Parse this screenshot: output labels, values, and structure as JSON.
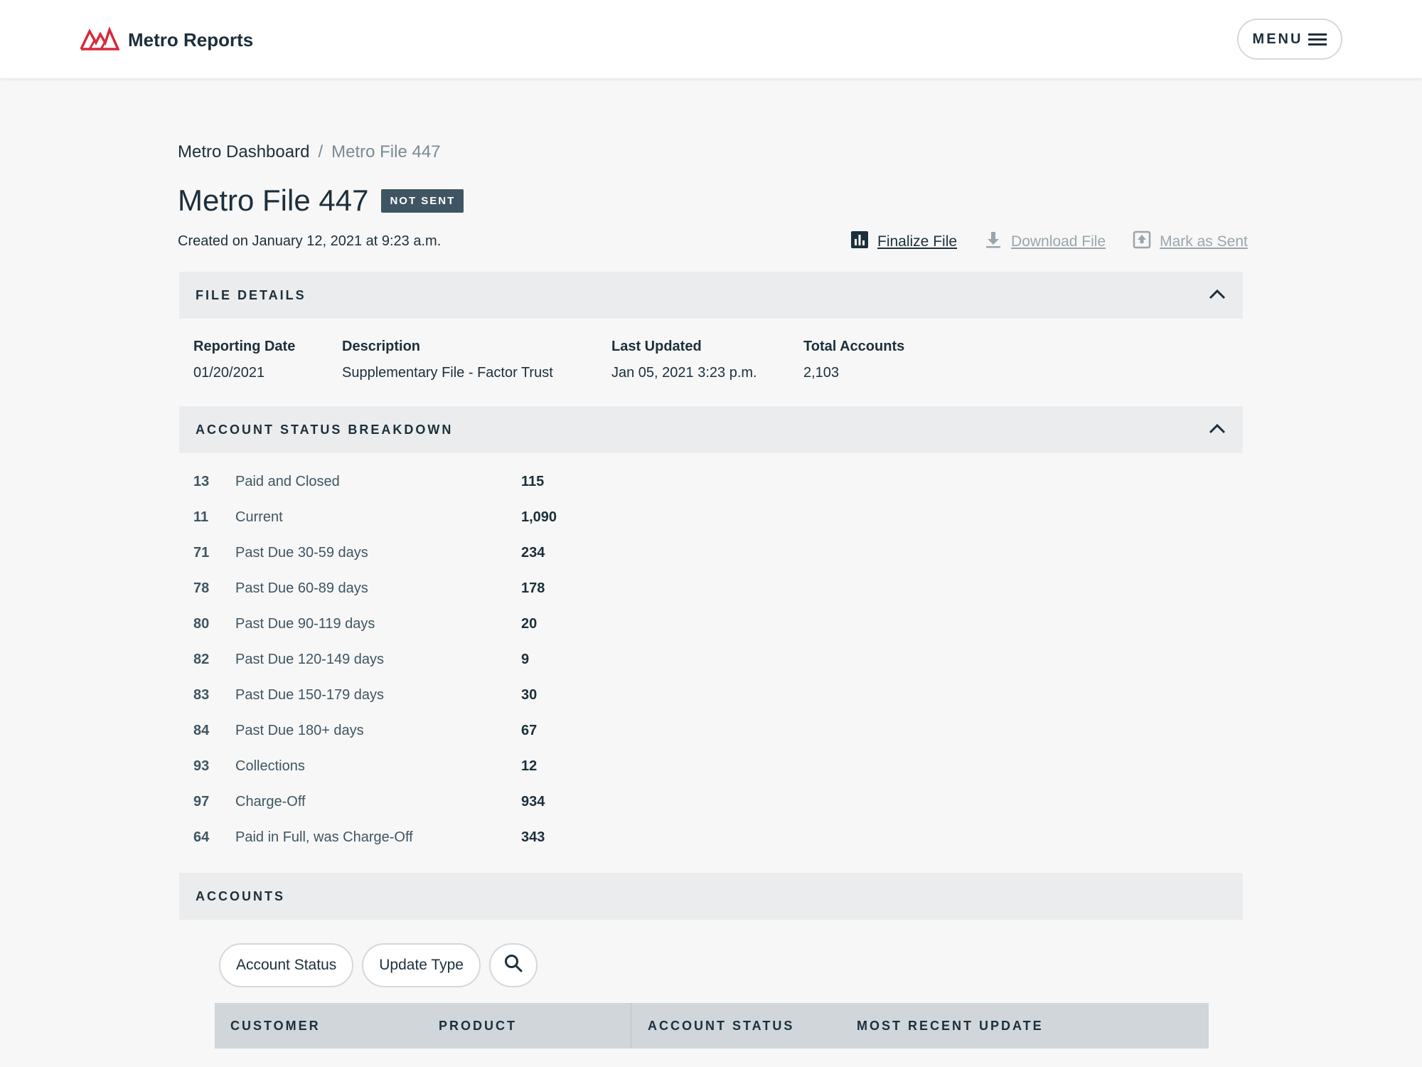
{
  "header": {
    "brand": "Metro Reports",
    "menu_label": "MENU"
  },
  "breadcrumb": {
    "parent": "Metro Dashboard",
    "separator": "/",
    "current": "Metro File 447"
  },
  "file": {
    "title": "Metro File 447",
    "status": "NOT SENT",
    "created": "Created on January 12, 2021 at 9:23 a.m."
  },
  "actions": {
    "finalize": "Finalize File",
    "download": "Download File",
    "mark_sent": "Mark as Sent"
  },
  "file_details": {
    "title": "FILE DETAILS",
    "fields": [
      {
        "label": "Reporting Date",
        "value": "01/20/2021"
      },
      {
        "label": "Description",
        "value": "Supplementary File - Factor Trust"
      },
      {
        "label": "Last Updated",
        "value": "Jan 05, 2021 3:23 p.m."
      },
      {
        "label": "Total Accounts",
        "value": "2,103"
      }
    ]
  },
  "breakdown": {
    "title": "ACCOUNT STATUS BREAKDOWN",
    "rows": [
      {
        "code": "13",
        "name": "Paid and Closed",
        "count": "115"
      },
      {
        "code": "11",
        "name": "Current",
        "count": "1,090"
      },
      {
        "code": "71",
        "name": "Past Due 30-59 days",
        "count": "234"
      },
      {
        "code": "78",
        "name": "Past Due 60-89 days",
        "count": "178"
      },
      {
        "code": "80",
        "name": "Past Due 90-119 days",
        "count": "20"
      },
      {
        "code": "82",
        "name": "Past Due 120-149 days",
        "count": "9"
      },
      {
        "code": "83",
        "name": "Past Due 150-179 days",
        "count": "30"
      },
      {
        "code": "84",
        "name": "Past Due 180+ days",
        "count": "67"
      },
      {
        "code": "93",
        "name": "Collections",
        "count": "12"
      },
      {
        "code": "97",
        "name": "Charge-Off",
        "count": "934"
      },
      {
        "code": "64",
        "name": "Paid in Full, was Charge-Off",
        "count": "343"
      }
    ]
  },
  "accounts": {
    "title": "ACCOUNTS",
    "filters": {
      "account_status": "Account Status",
      "update_type": "Update Type"
    },
    "columns": [
      "CUSTOMER",
      "PRODUCT",
      "ACCOUNT STATUS",
      "MOST RECENT UPDATE"
    ]
  },
  "colors": {
    "brand_red": "#d9283a",
    "navy": "#1c2f3b",
    "badge": "#3f5563",
    "section_bg": "#ebeced",
    "table_head_bg": "#d0d6da"
  },
  "icons": {
    "logo": "mountain-logo-icon",
    "menu": "hamburger-icon",
    "finalize": "bar-chart-icon",
    "download": "download-icon",
    "mark_sent": "upload-box-icon",
    "collapse": "chevron-up-icon",
    "search": "search-icon"
  }
}
